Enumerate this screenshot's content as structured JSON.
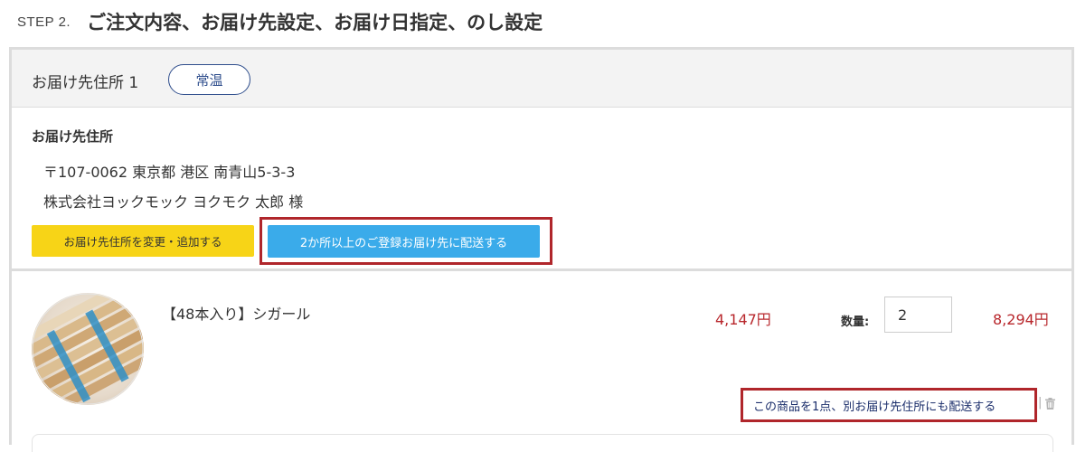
{
  "step": {
    "label": "STEP 2.",
    "title": "ご注文内容、お届け先設定、お届け日指定、のし設定"
  },
  "destination": {
    "title": "お届け先住所 1",
    "temperature_badge": "常温",
    "address_label": "お届け先住所",
    "address_line1": "〒107-0062 東京都 港区 南青山5-3-3",
    "address_line2": "株式会社ヨックモック ヨクモク 太郎 様",
    "change_button": "お届け先住所を変更・追加する",
    "multi_ship_button": "2か所以上のご登録お届け先に配送する"
  },
  "product": {
    "name": "【48本入り】シガール",
    "unit_price": "4,147円",
    "quantity_label": "数量:",
    "quantity_value": "2",
    "total_price": "8,294円",
    "ship_other_link": "この商品を1点、別お届け先住所にも配送する",
    "separator": "|",
    "image_icon": "product-photo-cigare",
    "trash_icon": "trash-icon"
  },
  "colors": {
    "accent_yellow": "#f7d417",
    "accent_blue": "#3aabea",
    "price_red": "#b8272c",
    "highlight_red": "#b0262b",
    "badge_navy": "#2e4d8c"
  }
}
